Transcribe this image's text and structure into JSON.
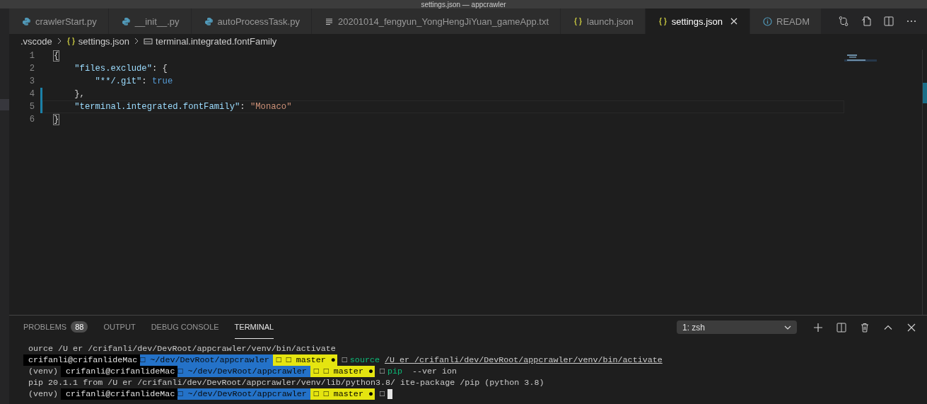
{
  "window": {
    "title": "settings.json — appcrawler"
  },
  "tabs": [
    {
      "label": "crawlerStart.py",
      "kind": "python",
      "selected": false
    },
    {
      "label": "__init__.py",
      "kind": "python",
      "selected": false
    },
    {
      "label": "autoProcessTask.py",
      "kind": "python",
      "selected": false
    },
    {
      "label": "20201014_fengyun_YongHengJiYuan_gameApp.txt",
      "kind": "text",
      "selected": false
    },
    {
      "label": "launch.json",
      "kind": "json",
      "selected": false
    },
    {
      "label": "settings.json",
      "kind": "json",
      "selected": true
    },
    {
      "label": "READM",
      "kind": "info",
      "selected": false
    }
  ],
  "breadcrumbs": [
    {
      "label": ".vscode",
      "kind": "folder"
    },
    {
      "label": "settings.json",
      "kind": "json"
    },
    {
      "label": "terminal.integrated.fontFamily",
      "kind": "string"
    }
  ],
  "editor": {
    "lines": [
      {
        "number": "1",
        "modified": false,
        "current": false,
        "tokens": [
          {
            "text": "{",
            "kind": "bracket"
          }
        ]
      },
      {
        "number": "2",
        "modified": false,
        "current": false,
        "tokens": [
          {
            "text": "    \"files.exclude\"",
            "kind": "key"
          },
          {
            "text": ": {",
            "kind": "punct"
          }
        ]
      },
      {
        "number": "3",
        "modified": false,
        "current": false,
        "tokens": [
          {
            "text": "        \"**/.git\"",
            "kind": "key"
          },
          {
            "text": ": ",
            "kind": "punct"
          },
          {
            "text": "true",
            "kind": "bool"
          }
        ]
      },
      {
        "number": "4",
        "modified": true,
        "current": false,
        "tokens": [
          {
            "text": "    },",
            "kind": "punct"
          }
        ]
      },
      {
        "number": "5",
        "modified": true,
        "current": true,
        "tokens": [
          {
            "text": "    \"terminal.integrated.fontFamily\"",
            "kind": "key"
          },
          {
            "text": ": ",
            "kind": "punct"
          },
          {
            "text": "\"Monaco\"",
            "kind": "string"
          }
        ]
      },
      {
        "number": "6",
        "modified": false,
        "current": false,
        "tokens": [
          {
            "text": "}",
            "kind": "bracket"
          }
        ]
      }
    ]
  },
  "panel": {
    "tabs": [
      {
        "label": "PROBLEMS",
        "badge": "88",
        "selected": false
      },
      {
        "label": "OUTPUT",
        "selected": false
      },
      {
        "label": "DEBUG CONSOLE",
        "selected": false
      },
      {
        "label": "TERMINAL",
        "selected": true
      }
    ],
    "terminal_select": {
      "value": "1: zsh"
    },
    "terminal": [
      {
        "cursor": false,
        "segments": [
          {
            "text": "ource /U er /crifanli/dev/DevRoot/appcrawler/venv/bin/activate",
            "kind": "plain"
          }
        ]
      },
      {
        "cursor": false,
        "segments": [
          {
            "text": "crifanli@crifanlideMac",
            "kind": "user"
          },
          {
            "text": "□ ~/dev/DevRoot/appcrawler",
            "kind": "path"
          },
          {
            "text": "□ □ master ●",
            "kind": "branch"
          },
          {
            "text": "□",
            "kind": "plain"
          },
          {
            "text": "source",
            "kind": "command"
          },
          {
            "text": "/U er /crifanli/dev/DevRoot/appcrawler/venv/bin/activate",
            "kind": "link"
          }
        ]
      },
      {
        "cursor": false,
        "segments": [
          {
            "text": "(venv)",
            "kind": "plain"
          },
          {
            "text": "crifanli@crifanlideMac",
            "kind": "user"
          },
          {
            "text": "□ ~/dev/DevRoot/appcrawler",
            "kind": "path"
          },
          {
            "text": "□ □ master ●",
            "kind": "branch"
          },
          {
            "text": "□",
            "kind": "plain"
          },
          {
            "text": "pip",
            "kind": "command"
          },
          {
            "text": "--ver ion",
            "kind": "plain"
          }
        ]
      },
      {
        "cursor": false,
        "segments": [
          {
            "text": "pip 20.1.1 from /U er /crifanli/dev/DevRoot/appcrawler/venv/lib/python3.8/ ite-package /pip (python 3.8)",
            "kind": "plain"
          }
        ]
      },
      {
        "cursor": true,
        "segments": [
          {
            "text": "(venv)",
            "kind": "plain"
          },
          {
            "text": "crifanli@crifanlideMac",
            "kind": "user"
          },
          {
            "text": "□ ~/dev/DevRoot/appcrawler",
            "kind": "path"
          },
          {
            "text": "□ □ master ●",
            "kind": "branch"
          },
          {
            "text": "□",
            "kind": "plain"
          }
        ]
      }
    ]
  }
}
